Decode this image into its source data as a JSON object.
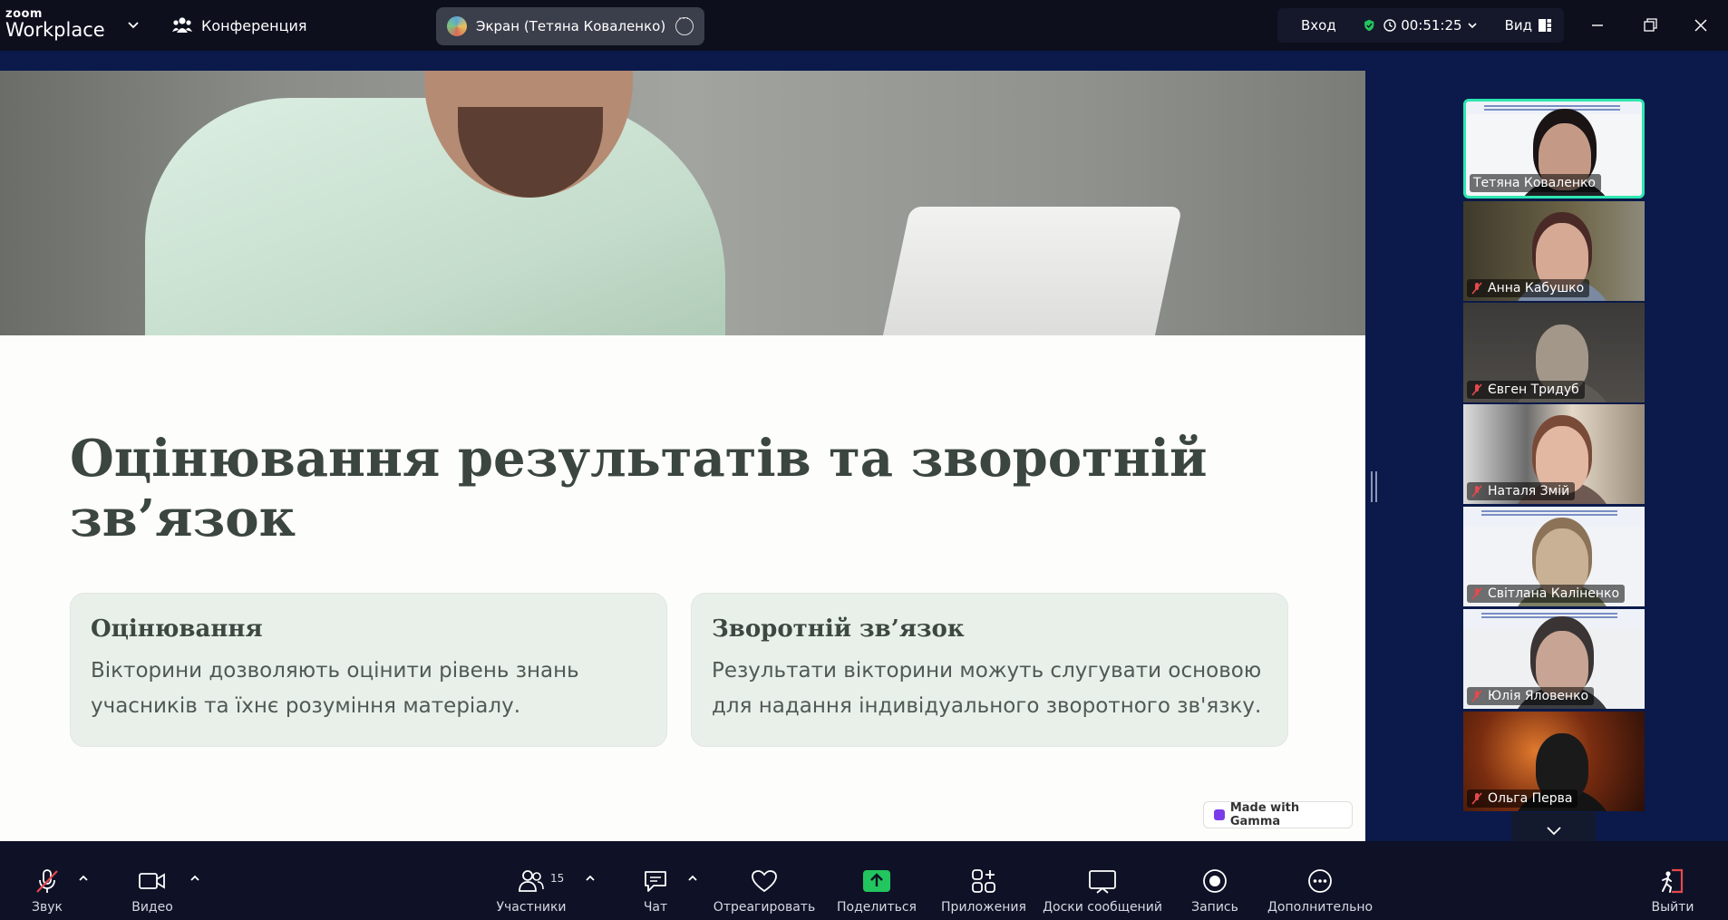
{
  "topbar": {
    "logo_small": "zoom",
    "logo_big": "Workplace",
    "conference_label": "Конференция",
    "screen_share_label": "Экран (Тетяна  Коваленко)",
    "enter_label": "Вход",
    "timer": "00:51:25",
    "view_label": "Вид"
  },
  "slide": {
    "title": "Оцінювання результатів та зворотній зв’язок",
    "cards": [
      {
        "heading": "Оцінювання",
        "text": "Вікторини дозволяють оцінити рівень знань учасників та їхнє розуміння матеріалу."
      },
      {
        "heading": "Зворотній зв’язок",
        "text": "Результати вікторини можуть слугувати основою для надання індивідуального зворотного зв'язку."
      }
    ],
    "badge": "Made with Gamma"
  },
  "participants": [
    {
      "name": "Тетяна  Коваленко",
      "muted": false,
      "active": true
    },
    {
      "name": "Анна Кабушко",
      "muted": true,
      "active": false
    },
    {
      "name": "Євген Тридуб",
      "muted": true,
      "active": false
    },
    {
      "name": "Наталя Змій",
      "muted": true,
      "active": false
    },
    {
      "name": "Світлана Каліненко",
      "muted": true,
      "active": false
    },
    {
      "name": "Юлія Яловенко",
      "muted": true,
      "active": false
    },
    {
      "name": "Ольга Перва",
      "muted": true,
      "active": false
    }
  ],
  "toolbar": {
    "audio": "Звук",
    "video": "Видео",
    "participants": "Участники",
    "participants_count": "15",
    "chat": "Чат",
    "react": "Отреагировать",
    "share": "Поделиться",
    "apps": "Приложения",
    "whiteboards": "Доски сообщений",
    "record": "Запись",
    "more": "Дополнительно",
    "leave": "Выйти"
  },
  "colors": {
    "accent_green": "#2ee6b0",
    "share_green": "#22c55e",
    "leave_red": "#e5484d",
    "mute_red": "#e5484d"
  }
}
